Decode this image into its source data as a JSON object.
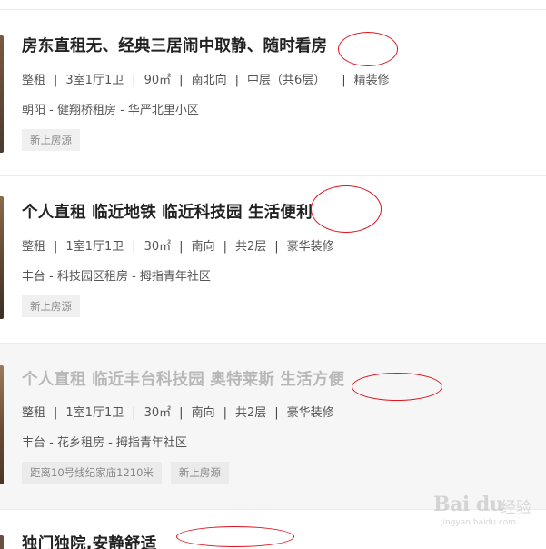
{
  "listings": [
    {
      "title": "房东直租无、经典三居闹中取静、随时看房",
      "attrs": [
        "整租",
        "3室1厅1卫",
        "90㎡",
        "南北向",
        "中层（共6层）",
        "精装修"
      ],
      "location": "朝阳 - 健翔桥租房 - 华严北里小区",
      "tags": [
        "新上房源"
      ]
    },
    {
      "title": "个人直租 临近地铁 临近科技园 生活便利",
      "attrs": [
        "整租",
        "1室1厅1卫",
        "30㎡",
        "南向",
        "共2层",
        "豪华装修"
      ],
      "location": "丰台 - 科技园区租房 - 拇指青年社区",
      "tags": [
        "新上房源"
      ]
    },
    {
      "title": "个人直租 临近丰台科技园 奥特莱斯 生活方便",
      "attrs": [
        "整租",
        "1室1厅1卫",
        "30㎡",
        "南向",
        "共2层",
        "豪华装修"
      ],
      "location": "丰台 - 花乡租房 - 拇指青年社区",
      "tags": [
        "距离10号线纪家庙1210米",
        "新上房源"
      ]
    },
    {
      "title": "独门独院,安静舒适",
      "attrs": [],
      "location": "",
      "tags": []
    }
  ],
  "watermark": {
    "logo": "Bai du",
    "text": "经验",
    "url": "jingyan.baidu.com"
  },
  "colors": {
    "annotation": "#e0141e",
    "tag_bg": "#f0f0f0",
    "dim_bg": "#f6f6f6"
  }
}
